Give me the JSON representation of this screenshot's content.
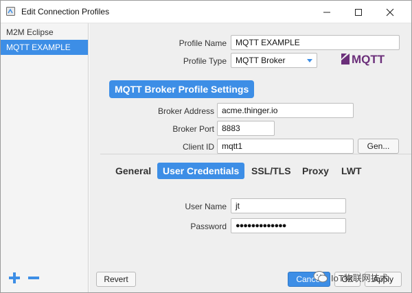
{
  "window": {
    "title": "Edit Connection Profiles"
  },
  "sidebar": {
    "items": [
      {
        "label": "M2M Eclipse"
      },
      {
        "label": "MQTT EXAMPLE"
      }
    ]
  },
  "profile": {
    "name_label": "Profile Name",
    "name_value": "MQTT EXAMPLE",
    "type_label": "Profile Type",
    "type_value": "MQTT Broker",
    "logo_text": "MQTT"
  },
  "section": {
    "title": "MQTT Broker Profile Settings"
  },
  "broker": {
    "address_label": "Broker Address",
    "address_value": "acme.thinger.io",
    "port_label": "Broker Port",
    "port_value": "8883",
    "client_label": "Client ID",
    "client_value": "mqtt1",
    "gen_label": "Gen..."
  },
  "tabs": [
    {
      "label": "General"
    },
    {
      "label": "User Credentials"
    },
    {
      "label": "SSL/TLS"
    },
    {
      "label": "Proxy"
    },
    {
      "label": "LWT"
    }
  ],
  "credentials": {
    "user_label": "User Name",
    "user_value": "jt",
    "password_label": "Password",
    "password_value": "●●●●●●●●●●●●●"
  },
  "footer": {
    "revert_label": "Revert",
    "cancel_label": "Cancel",
    "ok_label": "OK",
    "apply_label": "Apply"
  },
  "watermark": {
    "text": "IoT物联网技术"
  },
  "colors": {
    "accent": "#3d8ee6",
    "logo": "#6b2f7a"
  }
}
